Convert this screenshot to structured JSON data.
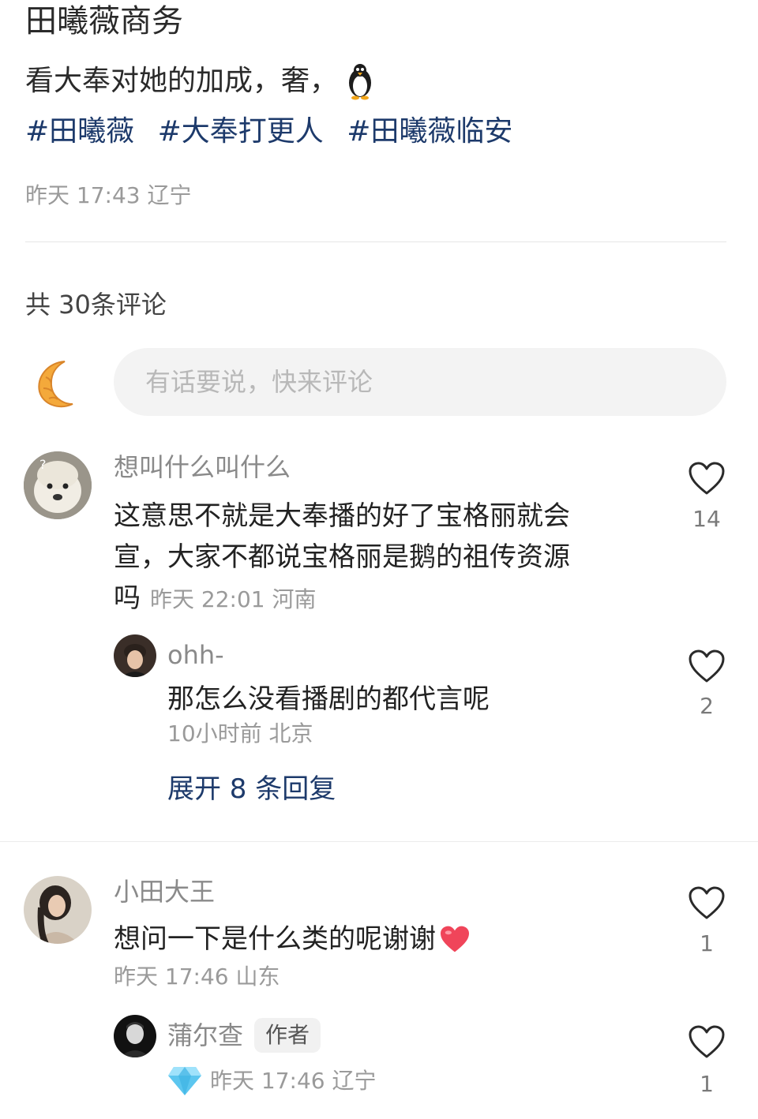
{
  "post": {
    "title": "田曦薇商务",
    "body": "看大奉对她的加成，奢，",
    "tags": [
      "#田曦薇",
      "#大奉打更人",
      "#田曦薇临安"
    ],
    "meta": "昨天 17:43 辽宁"
  },
  "comments_section": {
    "count_label": "共 30条评论",
    "input_placeholder": "有话要说，快来评论"
  },
  "comments": [
    {
      "name": "想叫什么叫什么",
      "text": "这意思不就是大奉播的好了宝格丽就会宣，大家不都说宝格丽是鹅的祖传资源吗",
      "line1": "这意思不就是大奉播的好了宝格丽就会",
      "line2": "宣，大家不都说宝格丽是鹅的祖传资源",
      "line3": "吗",
      "meta": "昨天 22:01 河南",
      "likes": "14",
      "reply": {
        "name": "ohh-",
        "text": "那怎么没看播剧的都代言呢",
        "meta": "10小时前 北京",
        "likes": "2"
      },
      "expand_label": "展开 8 条回复"
    },
    {
      "name": "小田大王",
      "text": "想问一下是什么类的呢谢谢",
      "meta": "昨天 17:46 山东",
      "likes": "1",
      "reply": {
        "name": "蒲尔查",
        "badge": "作者",
        "meta": "昨天 17:46 辽宁",
        "likes": "1"
      }
    }
  ],
  "icons": {
    "penguin": "penguin-emoji-icon",
    "heart": "heart-outline-icon",
    "red_heart": "red-heart-emoji-icon",
    "diamond": "diamond-icon",
    "moon": "crescent-moon-avatar-icon"
  },
  "colors": {
    "hashtag": "#1d3a6b",
    "meta": "#9a9a9a",
    "input_bg": "#f3f3f3"
  }
}
